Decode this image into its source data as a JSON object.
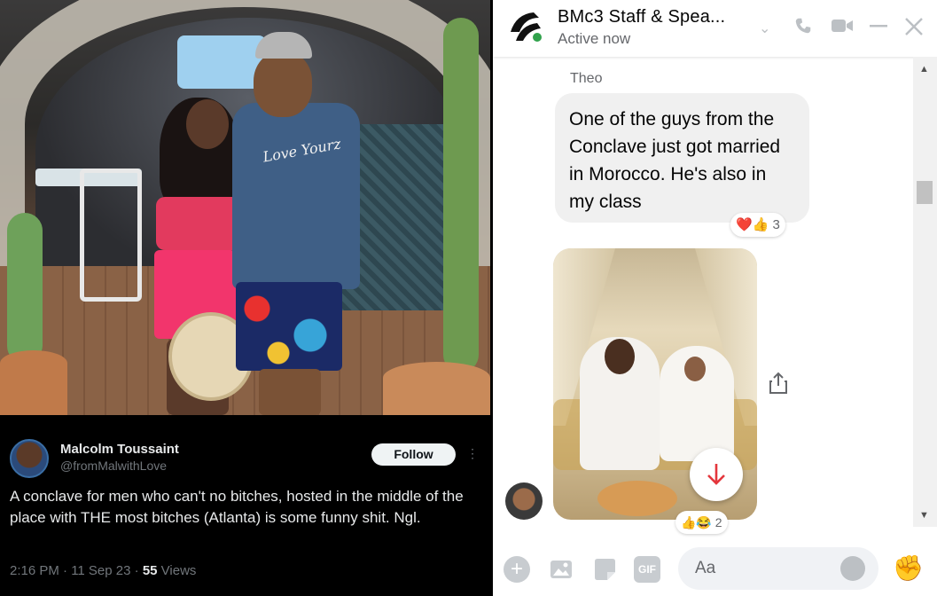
{
  "tweet": {
    "author_name": "Malcolm Toussaint",
    "author_handle": "@fromMalwithLove",
    "follow_label": "Follow",
    "more_icon": "more-vertical-icon",
    "text": "A conclave for men who can't no bitches, hosted in the middle of the place with THE most bitches (Atlanta) is some funny shit.  Ngl.",
    "time_date": "2:16 PM · 11 Sep 23 · ",
    "views_count": "55",
    "views_label": " Views",
    "shirt_print": "Love Yourz"
  },
  "messenger": {
    "chat_title": "BMc3 Staff & Spea...",
    "status": "Active now",
    "colors": {
      "online": "#31a24c",
      "accent": "#e4363c"
    },
    "messages": [
      {
        "sender": "Theo",
        "text": "One of the guys from the Conclave just got married in Morocco. He's also in my class",
        "reactions": "❤️👍",
        "reaction_count": "3"
      },
      {
        "type": "photo",
        "reactions": "👍😂",
        "reaction_count": "2"
      }
    ],
    "composer": {
      "placeholder": "Aa",
      "gif_label": "GIF"
    }
  }
}
